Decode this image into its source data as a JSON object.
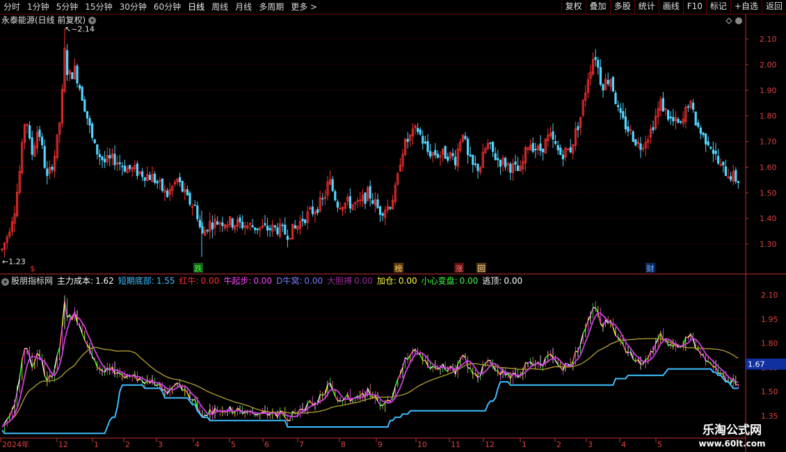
{
  "toolbar": {
    "periods": [
      "分时",
      "1分钟",
      "5分钟",
      "15分钟",
      "30分钟",
      "60分钟",
      "日线",
      "周线",
      "月线",
      "多周期",
      "更多 >"
    ],
    "active": "日线",
    "buttons": [
      "复权",
      "叠加",
      "多股",
      "统计",
      "画线",
      "F10",
      "标记",
      "+自选",
      "返回"
    ]
  },
  "chart": {
    "title": "永泰能源(日线 前复权)",
    "high_label": "2.14",
    "low_label": "1.23",
    "y_ticks": [
      "2.10",
      "2.00",
      "1.90",
      "1.80",
      "1.70",
      "1.60",
      "1.50",
      "1.40",
      "1.30"
    ],
    "markers": [
      "$",
      "跌",
      "榜",
      "涨",
      "回",
      "财"
    ],
    "colors": {
      "up": "#ff3232",
      "down": "#54d6ff",
      "grid": "#7a0000",
      "axis": "#c83030"
    }
  },
  "indicator": {
    "name": "股朋指标网",
    "items": [
      {
        "label": "主力成本:",
        "value": "1.62",
        "color": "#ffffff"
      },
      {
        "label": "短期底部:",
        "value": "1.55",
        "color": "#3fc0ff"
      },
      {
        "label": "红牛:",
        "value": "0.00",
        "color": "#ff3030"
      },
      {
        "label": "牛起步:",
        "value": "0.00",
        "color": "#ff44ff"
      },
      {
        "label": "D牛窝:",
        "value": "0.00",
        "color": "#7c7cff"
      },
      {
        "label": "大胆搏",
        "value": "0.00",
        "color": "#9b2a9b"
      },
      {
        "label": "加仓:",
        "value": "0.00",
        "color": "#ffff40"
      },
      {
        "label": "小心变盘:",
        "value": "0.00",
        "color": "#40ff40"
      },
      {
        "label": "逃顶:",
        "value": "0.00",
        "color": "#ffffff"
      }
    ],
    "y_ticks": [
      "2.10",
      "1.95",
      "1.80",
      "1.65",
      "1.50",
      "1.35"
    ],
    "current_value": "1.67"
  },
  "x_axis": [
    "2024年",
    "12",
    "1",
    "2",
    "3",
    "4",
    "5",
    "6",
    "7",
    "8",
    "9",
    "10",
    "11",
    "12",
    "1",
    "2",
    "3",
    "4",
    "5"
  ],
  "watermark": {
    "line1": "乐淘公式网",
    "line2": "www.60lt.com"
  },
  "chart_data": {
    "type": "line",
    "title": "永泰能源(日线 前复权)",
    "xlabel": "",
    "ylabel": "",
    "ylim": [
      1.2,
      2.2
    ],
    "categories": [
      "2024年",
      "12",
      "1",
      "2",
      "3",
      "4",
      "5",
      "6",
      "7",
      "8",
      "9",
      "10",
      "11",
      "12",
      "1",
      "2",
      "3",
      "4",
      "5"
    ],
    "series": [
      {
        "name": "close",
        "values": [
          1.28,
          1.95,
          1.72,
          1.61,
          1.56,
          1.48,
          1.38,
          1.37,
          1.36,
          1.47,
          1.46,
          1.65,
          1.64,
          1.6,
          1.65,
          1.8,
          2.0,
          1.72,
          1.8,
          1.55
        ]
      },
      {
        "name": "主力成本",
        "values": [
          1.35,
          1.7,
          1.78,
          1.66,
          1.6,
          1.55,
          1.45,
          1.39,
          1.38,
          1.42,
          1.46,
          1.55,
          1.64,
          1.62,
          1.64,
          1.72,
          1.9,
          1.8,
          1.76,
          1.62
        ]
      },
      {
        "name": "短期底部",
        "values": [
          1.28,
          1.4,
          1.6,
          1.6,
          1.58,
          1.52,
          1.38,
          1.36,
          1.34,
          1.34,
          1.4,
          1.47,
          1.62,
          1.62,
          1.62,
          1.63,
          1.68,
          1.71,
          1.7,
          1.55
        ]
      }
    ]
  }
}
